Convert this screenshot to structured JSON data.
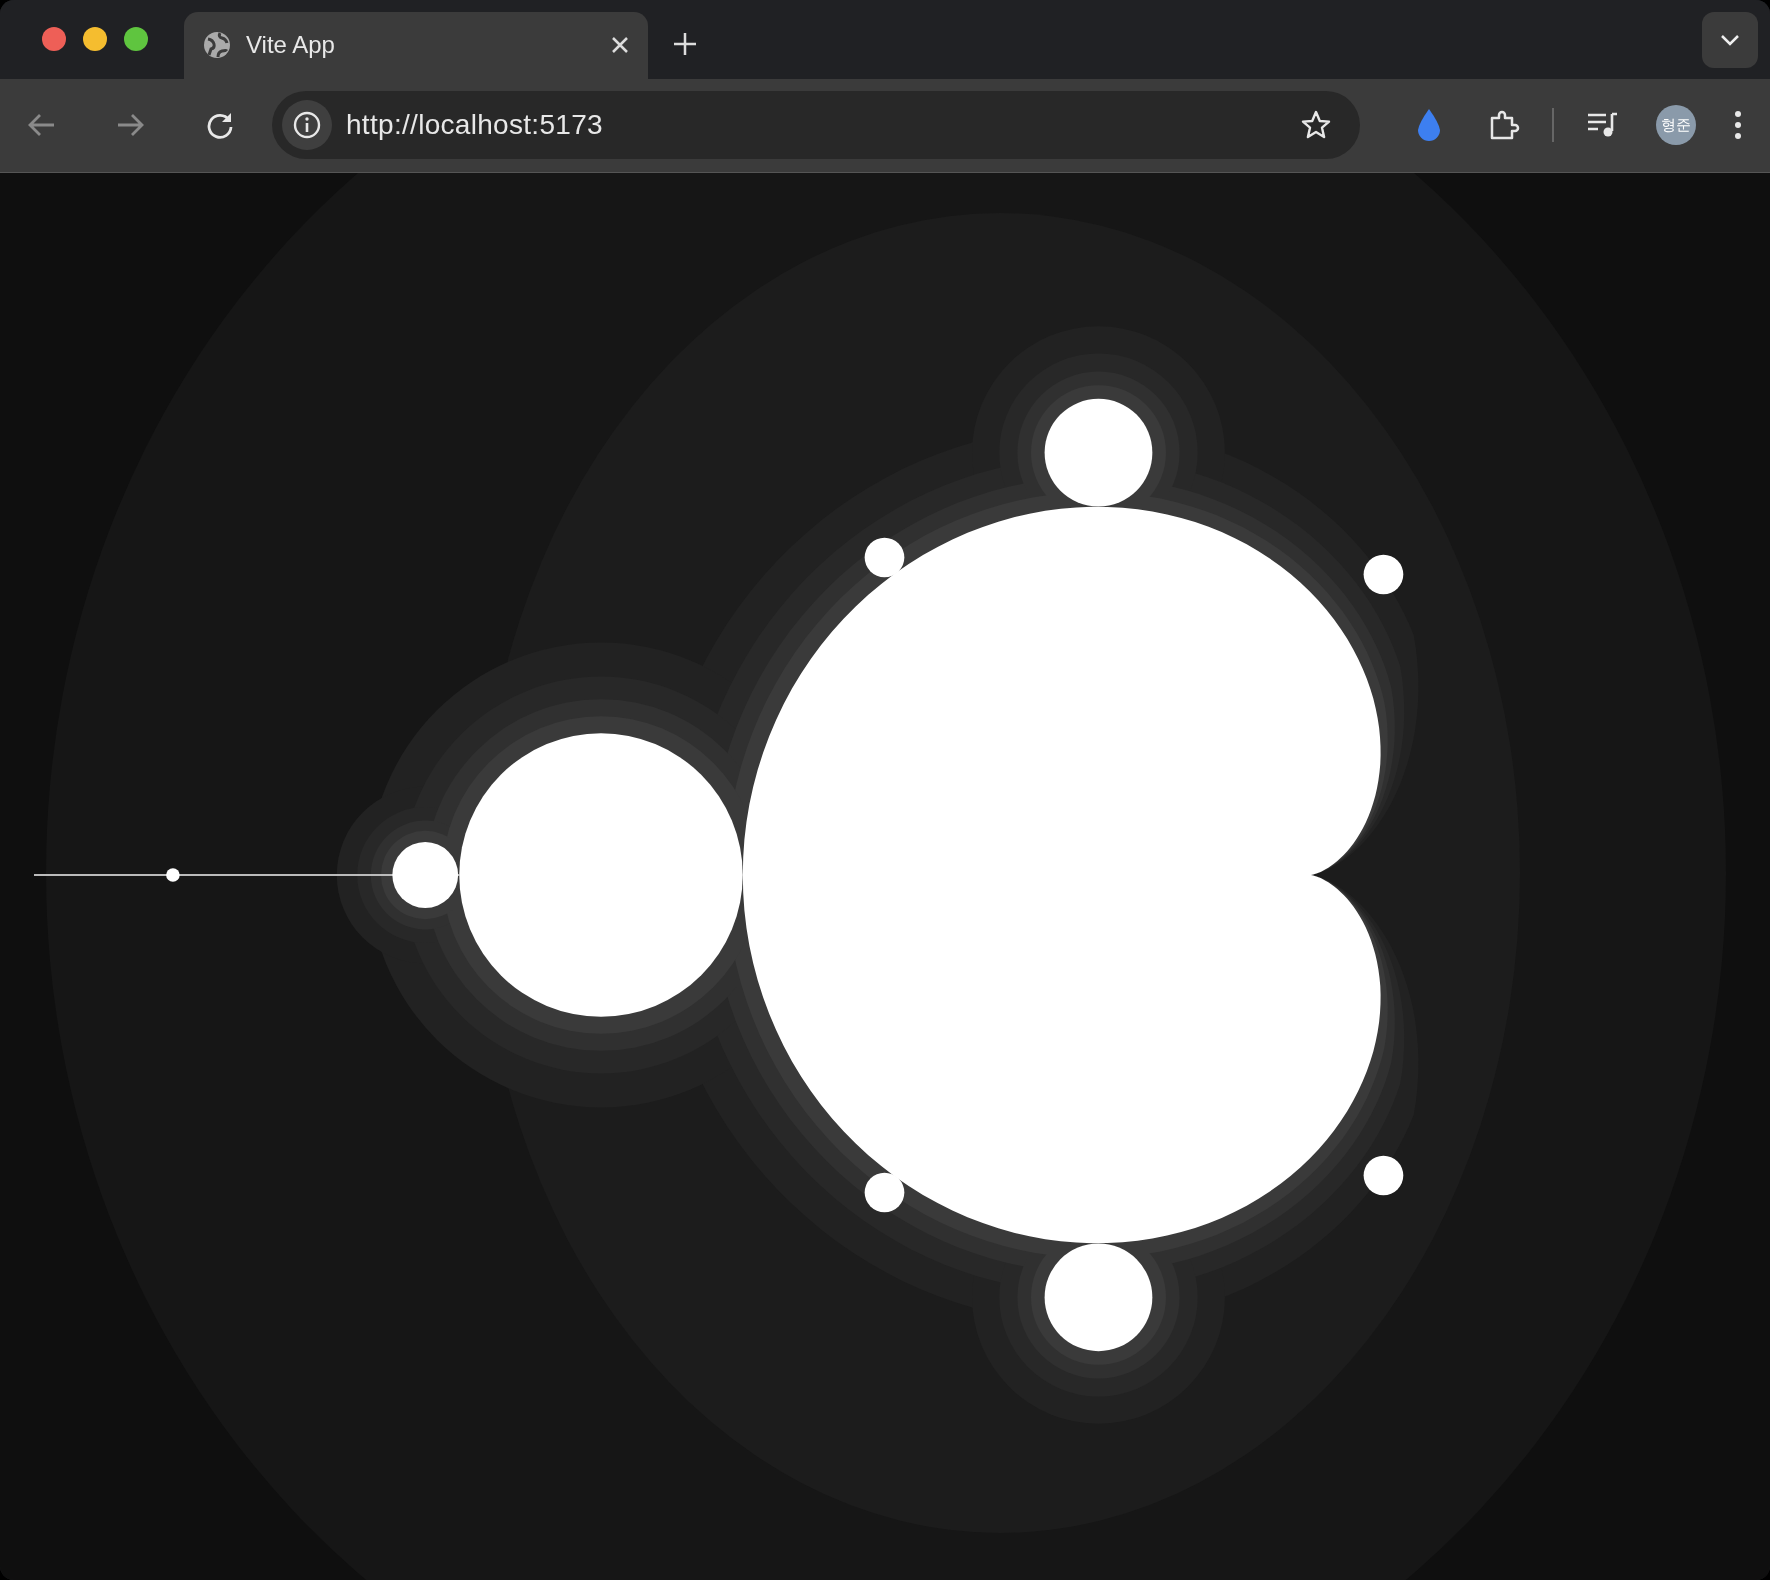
{
  "tabs": [
    {
      "title": "Vite App",
      "selected": true
    }
  ],
  "toolbar": {
    "back": {
      "disabled": true
    },
    "forward": {
      "disabled": true
    },
    "url": "http://localhost:5173"
  },
  "profile": {
    "initials": "형준"
  }
}
